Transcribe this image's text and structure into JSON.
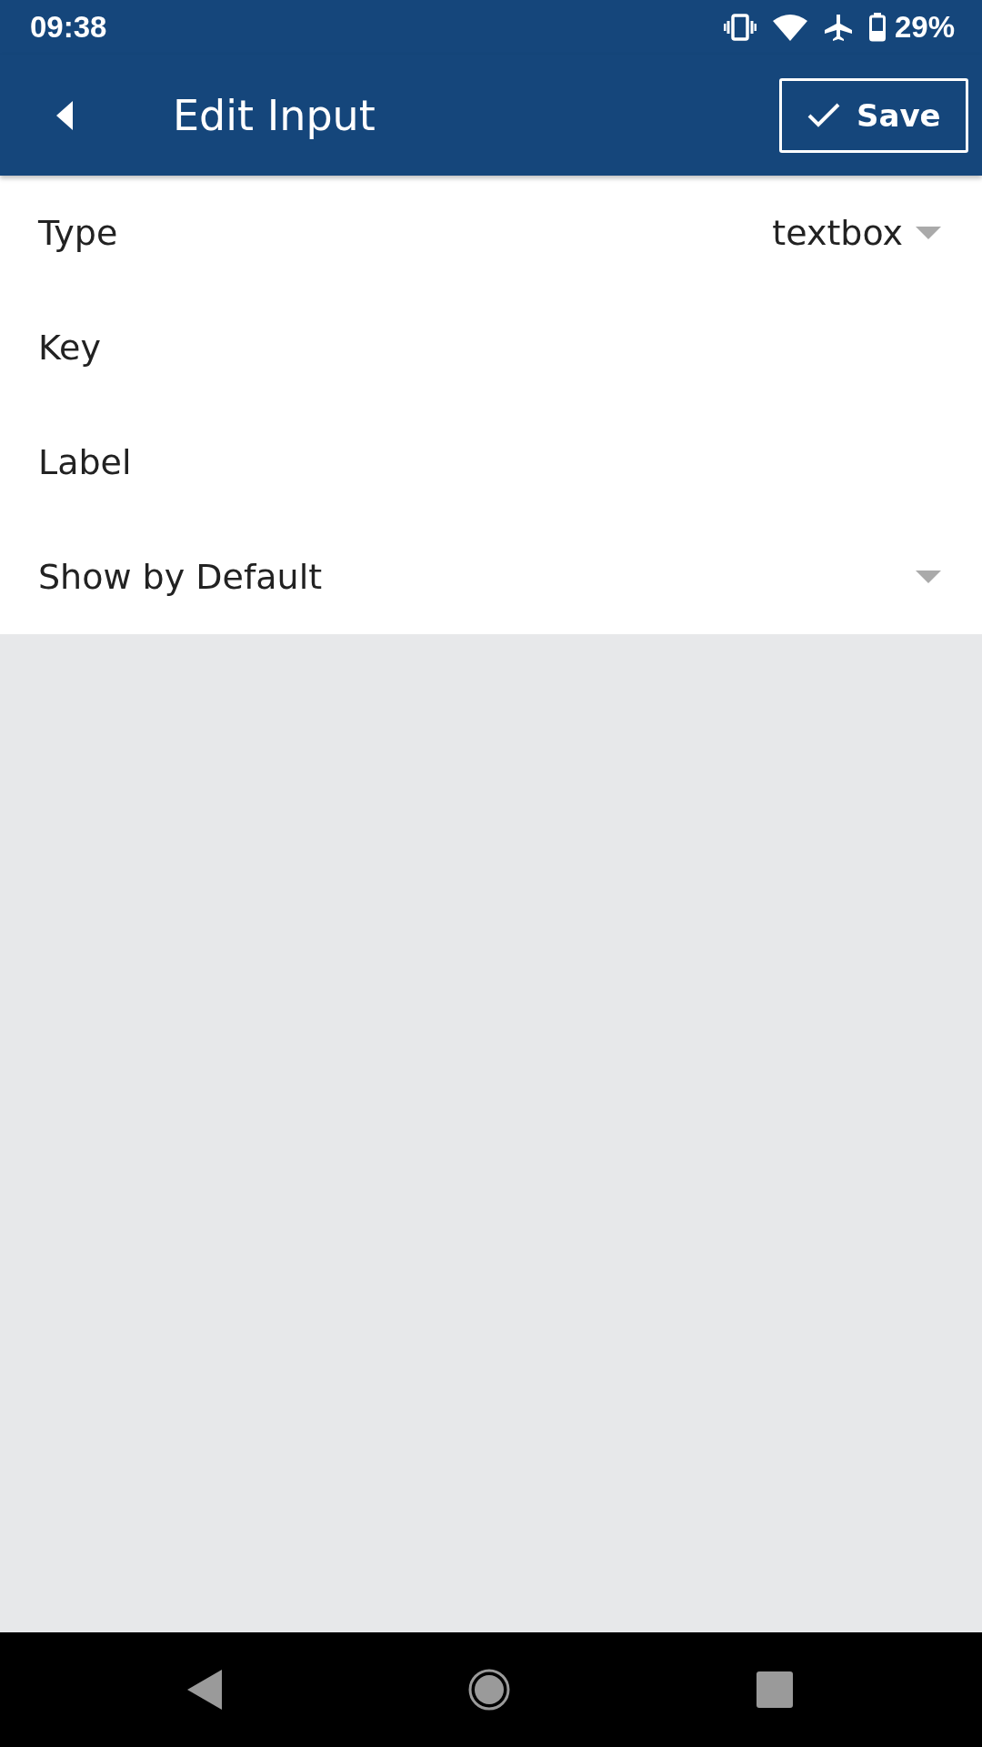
{
  "status_bar": {
    "time": "09:38",
    "battery": "29%"
  },
  "app_bar": {
    "title": "Edit Input",
    "save_label": "Save"
  },
  "fields": [
    {
      "kind": "dropdown",
      "label": "Type",
      "value": "textbox"
    },
    {
      "kind": "text",
      "label": "Key"
    },
    {
      "kind": "text",
      "label": "Label"
    },
    {
      "kind": "dropdown",
      "label": "Show by Default"
    }
  ]
}
